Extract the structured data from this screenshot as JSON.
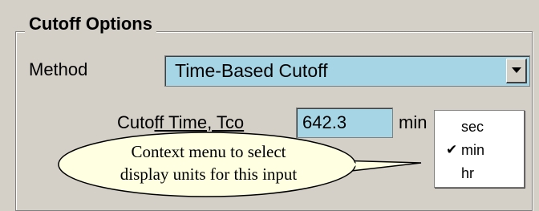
{
  "group": {
    "title": "Cutoff Options"
  },
  "method": {
    "label": "Method",
    "value": "Time-Based Cutoff",
    "dropdown_icon": "chevron-down-icon"
  },
  "cutoff": {
    "label_prefix": "Cuto",
    "label_underlined": "ff Time, Tco",
    "value": "642.3",
    "unit": "min"
  },
  "context_menu": {
    "items": [
      {
        "label": "sec",
        "checked": false
      },
      {
        "label": "min",
        "checked": true
      },
      {
        "label": "hr",
        "checked": false
      }
    ],
    "check_icon": "checkmark-icon"
  },
  "callout": {
    "line1": "Context menu to select",
    "line2": "display units for this input",
    "fill_color": "#ffffe1"
  },
  "colors": {
    "input_bg": "#a6d6e6",
    "window_bg": "#d4d0c8"
  }
}
